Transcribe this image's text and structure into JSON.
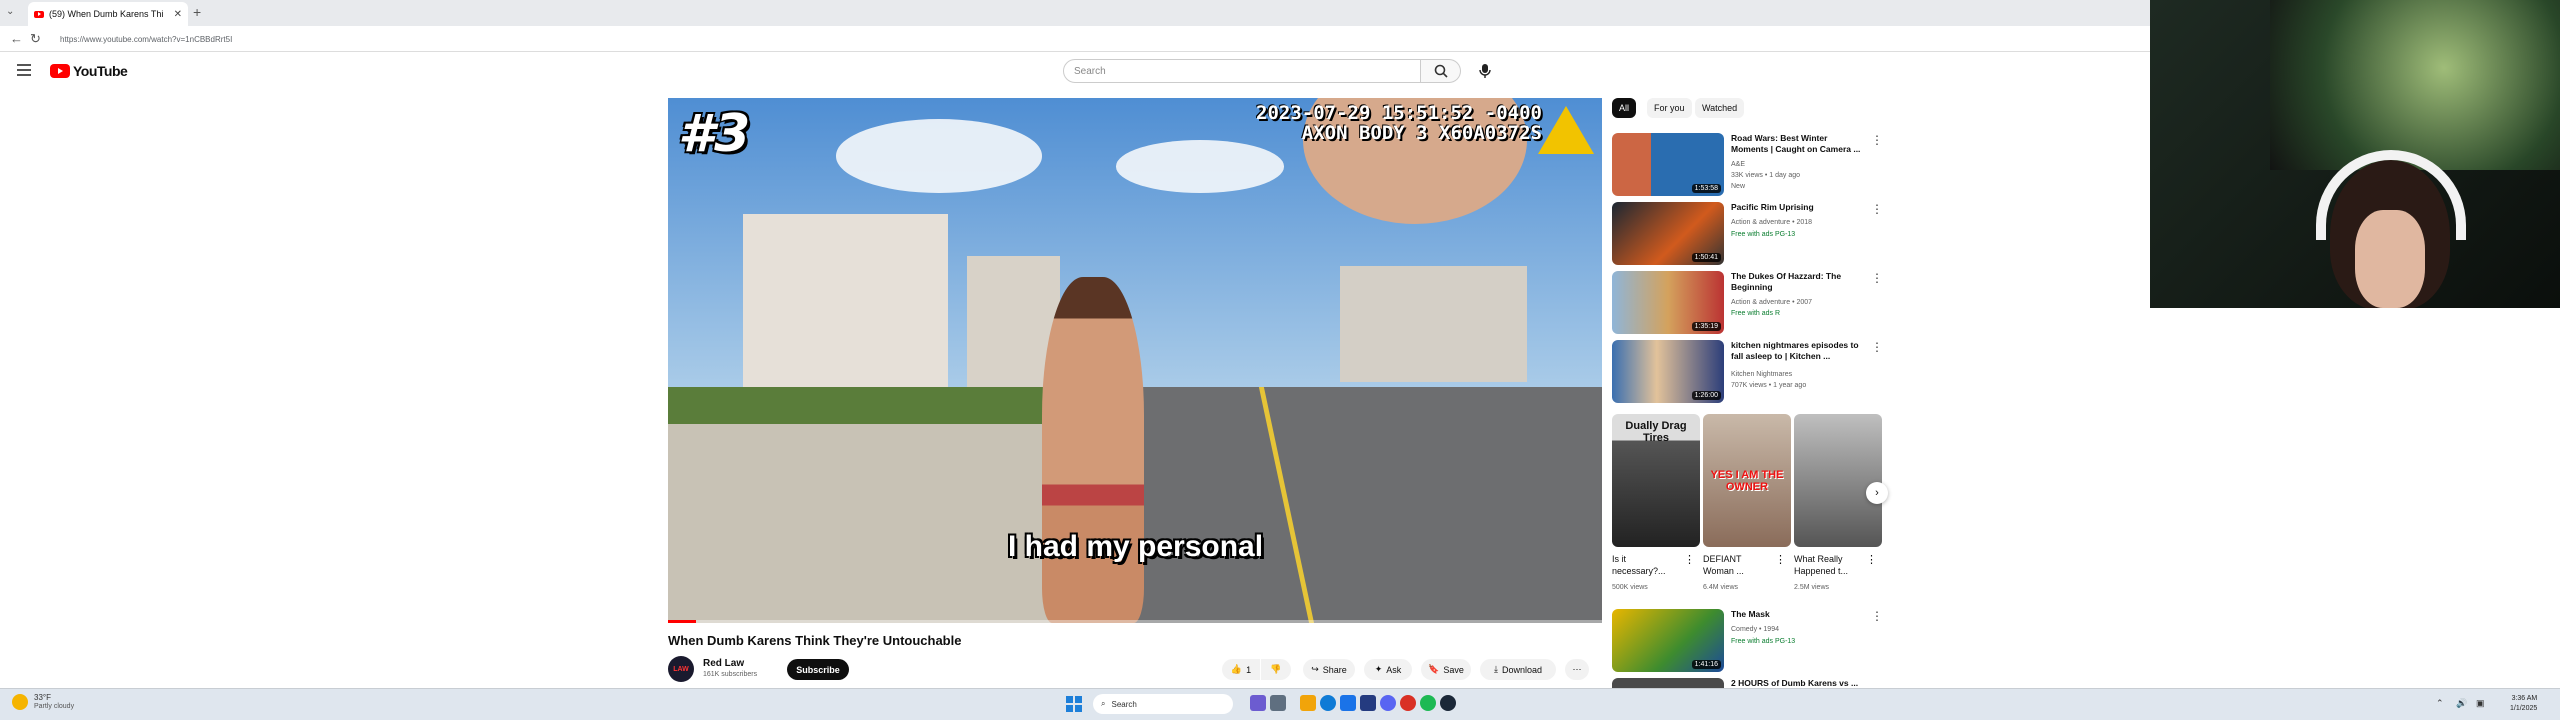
{
  "browser": {
    "tab_title": "(59) When Dumb Karens Thi",
    "tab_close": "✕",
    "new_tab": "+",
    "url": "https://www.youtube.com/watch?v=1nCBBdRrt5I"
  },
  "header": {
    "logo": "YouTube",
    "search_placeholder": "Search"
  },
  "video": {
    "rank_overlay": "#3",
    "cam_timestamp": "2023-07-29 15:51:52 -0400",
    "cam_id": "AXON BODY 3 X60A0372S",
    "caption": "I had my personal",
    "progress_fraction": 0.03,
    "title": "When Dumb Karens Think They're Untouchable",
    "channel_name": "Red Law",
    "channel_subs": "161K subscribers",
    "channel_avatar_text": "LAW",
    "subscribe": "Subscribe",
    "like_count": "1",
    "share": "Share",
    "ask": "Ask",
    "save": "Save",
    "download": "Download"
  },
  "sidebar": {
    "chips": [
      "All",
      "For you",
      "Watched"
    ],
    "recs_top": [
      {
        "title": "Road Wars: Best Winter Moments | Caught on Camera ...",
        "channel": "A&E",
        "meta": "33K views • 1 day ago",
        "badge": "New",
        "duration": "1:53:58"
      },
      {
        "title": "Pacific Rim Uprising",
        "channel": "Action & adventure • 2018",
        "meta": "",
        "badge": "Free with ads  PG-13",
        "duration": "1:50:41"
      },
      {
        "title": "The Dukes Of Hazzard: The Beginning",
        "channel": "Action & adventure • 2007",
        "meta": "",
        "badge": "Free with ads  R",
        "duration": "1:35:19"
      },
      {
        "title": "kitchen nightmares episodes to fall asleep to | Kitchen ...",
        "channel": "Kitchen Nightmares",
        "meta": "707K views • 1 year ago",
        "badge": "",
        "duration": "1:26:00"
      }
    ],
    "shorts": [
      {
        "title": "Is it necessary?...",
        "views": "500K views",
        "overlay": "Dually Drag Tires"
      },
      {
        "title": "DEFIANT Woman ...",
        "views": "6.4M views",
        "overlay": "YES I AM THE OWNER"
      },
      {
        "title": "What Really Happened t...",
        "views": "2.5M views",
        "overlay": ""
      }
    ],
    "recs_bottom": [
      {
        "title": "The Mask",
        "channel": "Comedy • 1994",
        "meta": "",
        "badge": "Free with ads  PG-13",
        "duration": "1:41:16"
      },
      {
        "title": "2 HOURS of Dumb Karens vs ...",
        "channel": "",
        "meta": "",
        "badge": "",
        "duration": ""
      }
    ]
  },
  "taskbar": {
    "weather_temp": "33°F",
    "weather_desc": "Partly cloudy",
    "search_label": "Search",
    "time": "3:36 AM",
    "date": "1/1/2025"
  },
  "colors": {
    "accent": "#ff0000",
    "subscribe_bg": "#0f0f0f",
    "badge_green": "#0a7d2f"
  }
}
